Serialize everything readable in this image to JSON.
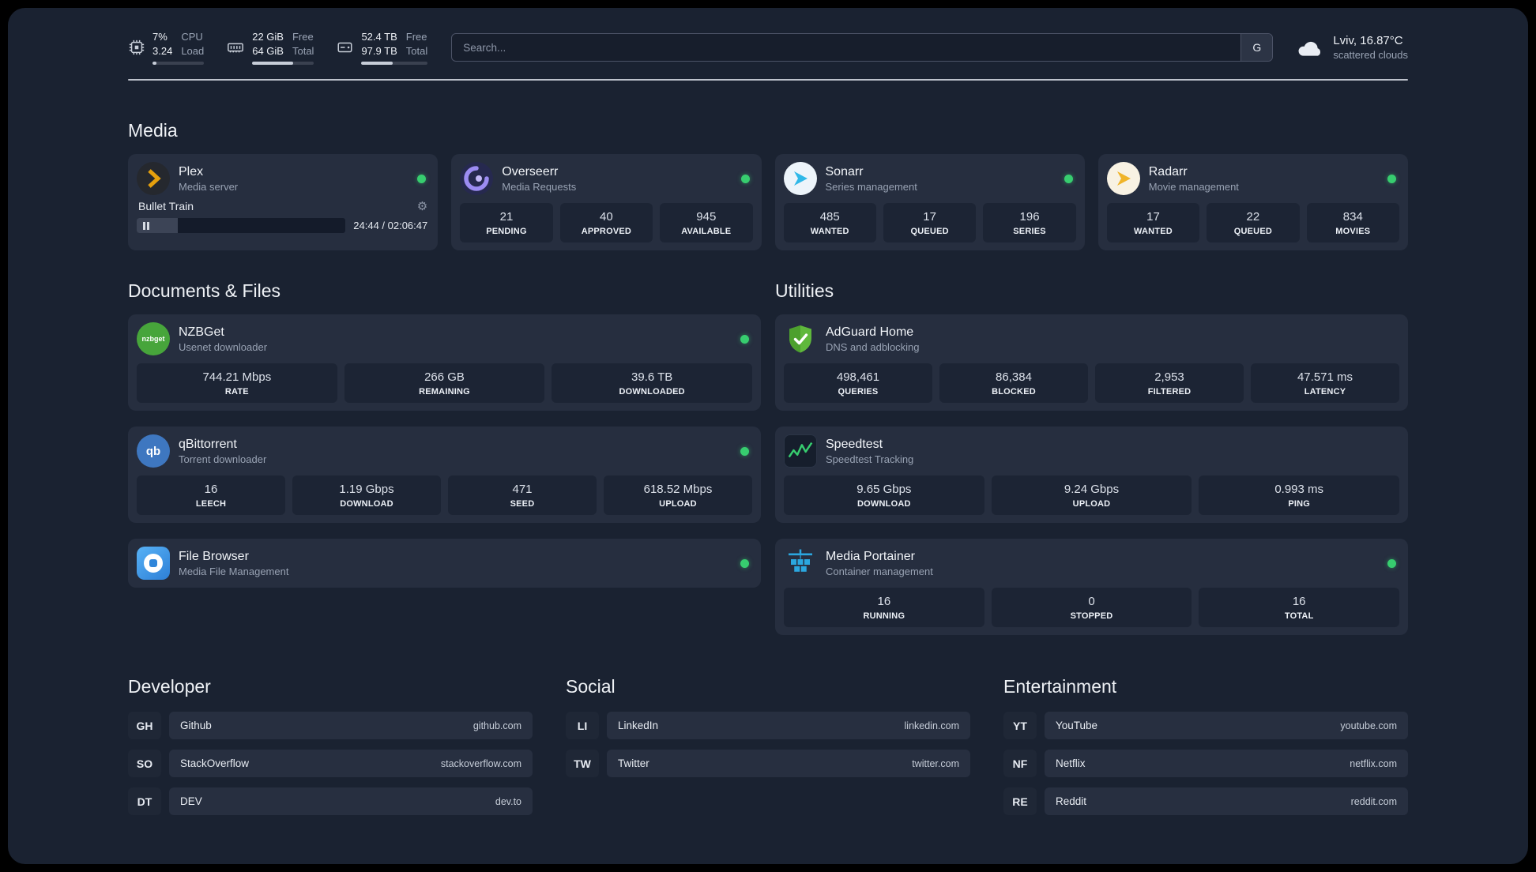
{
  "topbar": {
    "cpu": {
      "value1": "7%",
      "value2": "3.24",
      "label1": "CPU",
      "label2": "Load",
      "bar_percent": 7
    },
    "ram": {
      "value1": "22 GiB",
      "value2": "64 GiB",
      "label1": "Free",
      "label2": "Total",
      "bar_percent": 66
    },
    "disk": {
      "value1": "52.4 TB",
      "value2": "97.9 TB",
      "label1": "Free",
      "label2": "Total",
      "bar_percent": 47
    },
    "search": {
      "placeholder": "Search...",
      "engine_label": "G"
    },
    "weather": {
      "location": "Lviv, 16.87°C",
      "condition": "scattered clouds"
    }
  },
  "icons": {
    "gear": "⚙"
  },
  "colors": {
    "status_online": "#37cd6f",
    "plex_accent": "#e5a00d"
  },
  "sections": {
    "media": {
      "title": "Media",
      "plex": {
        "name": "Plex",
        "subtitle": "Media server",
        "now_playing": {
          "title": "Bullet Train",
          "time": "24:44 / 02:06:47",
          "progress_percent": 19.5
        }
      },
      "overseerr": {
        "name": "Overseerr",
        "subtitle": "Media Requests",
        "stats": [
          {
            "value": "21",
            "label": "PENDING"
          },
          {
            "value": "40",
            "label": "APPROVED"
          },
          {
            "value": "945",
            "label": "AVAILABLE"
          }
        ]
      },
      "sonarr": {
        "name": "Sonarr",
        "subtitle": "Series management",
        "stats": [
          {
            "value": "485",
            "label": "WANTED"
          },
          {
            "value": "17",
            "label": "QUEUED"
          },
          {
            "value": "196",
            "label": "SERIES"
          }
        ]
      },
      "radarr": {
        "name": "Radarr",
        "subtitle": "Movie management",
        "stats": [
          {
            "value": "17",
            "label": "WANTED"
          },
          {
            "value": "22",
            "label": "QUEUED"
          },
          {
            "value": "834",
            "label": "MOVIES"
          }
        ]
      }
    },
    "documents": {
      "title": "Documents & Files",
      "nzbget": {
        "name": "NZBGet",
        "subtitle": "Usenet downloader",
        "icon_text": "nzbget",
        "stats": [
          {
            "value": "744.21 Mbps",
            "label": "RATE"
          },
          {
            "value": "266 GB",
            "label": "REMAINING"
          },
          {
            "value": "39.6 TB",
            "label": "DOWNLOADED"
          }
        ]
      },
      "qbittorrent": {
        "name": "qBittorrent",
        "subtitle": "Torrent downloader",
        "icon_text": "qb",
        "stats": [
          {
            "value": "16",
            "label": "LEECH"
          },
          {
            "value": "1.19 Gbps",
            "label": "DOWNLOAD"
          },
          {
            "value": "471",
            "label": "SEED"
          },
          {
            "value": "618.52 Mbps",
            "label": "UPLOAD"
          }
        ]
      },
      "filebrowser": {
        "name": "File Browser",
        "subtitle": "Media File Management"
      }
    },
    "utilities": {
      "title": "Utilities",
      "adguard": {
        "name": "AdGuard Home",
        "subtitle": "DNS and adblocking",
        "stats": [
          {
            "value": "498,461",
            "label": "QUERIES"
          },
          {
            "value": "86,384",
            "label": "BLOCKED"
          },
          {
            "value": "2,953",
            "label": "FILTERED"
          },
          {
            "value": "47.571 ms",
            "label": "LATENCY"
          }
        ]
      },
      "speedtest": {
        "name": "Speedtest",
        "subtitle": "Speedtest Tracking",
        "stats": [
          {
            "value": "9.65 Gbps",
            "label": "DOWNLOAD"
          },
          {
            "value": "9.24 Gbps",
            "label": "UPLOAD"
          },
          {
            "value": "0.993 ms",
            "label": "PING"
          }
        ]
      },
      "portainer": {
        "name": "Media Portainer",
        "subtitle": "Container management",
        "stats": [
          {
            "value": "16",
            "label": "RUNNING"
          },
          {
            "value": "0",
            "label": "STOPPED"
          },
          {
            "value": "16",
            "label": "TOTAL"
          }
        ]
      }
    },
    "bookmarks": {
      "developer": {
        "title": "Developer",
        "items": [
          {
            "abbr": "GH",
            "name": "Github",
            "url": "github.com"
          },
          {
            "abbr": "SO",
            "name": "StackOverflow",
            "url": "stackoverflow.com"
          },
          {
            "abbr": "DT",
            "name": "DEV",
            "url": "dev.to"
          }
        ]
      },
      "social": {
        "title": "Social",
        "items": [
          {
            "abbr": "LI",
            "name": "LinkedIn",
            "url": "linkedin.com"
          },
          {
            "abbr": "TW",
            "name": "Twitter",
            "url": "twitter.com"
          }
        ]
      },
      "entertainment": {
        "title": "Entertainment",
        "items": [
          {
            "abbr": "YT",
            "name": "YouTube",
            "url": "youtube.com"
          },
          {
            "abbr": "NF",
            "name": "Netflix",
            "url": "netflix.com"
          },
          {
            "abbr": "RE",
            "name": "Reddit",
            "url": "reddit.com"
          }
        ]
      }
    }
  }
}
